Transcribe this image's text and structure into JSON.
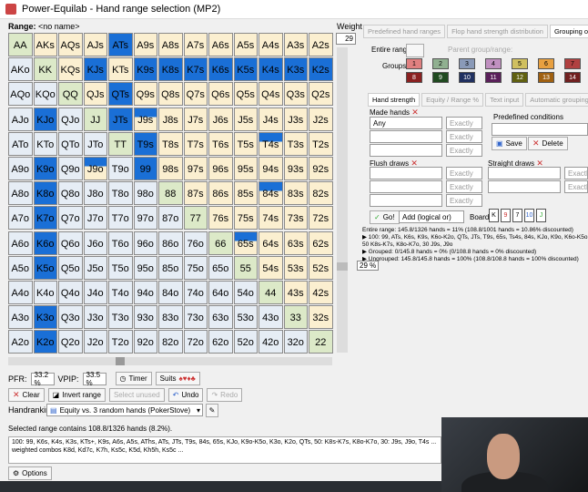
{
  "window": {
    "title": "Power-Equilab - Hand range selection (MP2)"
  },
  "range": {
    "label": "Range:",
    "name": "<no name>"
  },
  "weight": {
    "label": "Weight",
    "value": "29"
  },
  "matrix": [
    [
      "AA",
      "AKs",
      "AQs",
      "AJs",
      "ATs",
      "A9s",
      "A8s",
      "A7s",
      "A6s",
      "A5s",
      "A4s",
      "A3s",
      "A2s"
    ],
    [
      "AKo",
      "KK",
      "KQs",
      "KJs",
      "KTs",
      "K9s",
      "K8s",
      "K7s",
      "K6s",
      "K5s",
      "K4s",
      "K3s",
      "K2s"
    ],
    [
      "AQo",
      "KQo",
      "QQ",
      "QJs",
      "QTs",
      "Q9s",
      "Q8s",
      "Q7s",
      "Q6s",
      "Q5s",
      "Q4s",
      "Q3s",
      "Q2s"
    ],
    [
      "AJo",
      "KJo",
      "QJo",
      "JJ",
      "JTs",
      "J9s",
      "J8s",
      "J7s",
      "J6s",
      "J5s",
      "J4s",
      "J3s",
      "J2s"
    ],
    [
      "ATo",
      "KTo",
      "QTo",
      "JTo",
      "TT",
      "T9s",
      "T8s",
      "T7s",
      "T6s",
      "T5s",
      "T4s",
      "T3s",
      "T2s"
    ],
    [
      "A9o",
      "K9o",
      "Q9o",
      "J9o",
      "T9o",
      "99",
      "98s",
      "97s",
      "96s",
      "95s",
      "94s",
      "93s",
      "92s"
    ],
    [
      "A8o",
      "K8o",
      "Q8o",
      "J8o",
      "T8o",
      "98o",
      "88",
      "87s",
      "86s",
      "85s",
      "84s",
      "83s",
      "82s"
    ],
    [
      "A7o",
      "K7o",
      "Q7o",
      "J7o",
      "T7o",
      "97o",
      "87o",
      "77",
      "76s",
      "75s",
      "74s",
      "73s",
      "72s"
    ],
    [
      "A6o",
      "K6o",
      "Q6o",
      "J6o",
      "T6o",
      "96o",
      "86o",
      "76o",
      "66",
      "65s",
      "64s",
      "63s",
      "62s"
    ],
    [
      "A5o",
      "K5o",
      "Q5o",
      "J5o",
      "T5o",
      "95o",
      "85o",
      "75o",
      "65o",
      "55",
      "54s",
      "53s",
      "52s"
    ],
    [
      "A4o",
      "K4o",
      "Q4o",
      "J4o",
      "T4o",
      "94o",
      "84o",
      "74o",
      "64o",
      "54o",
      "44",
      "43s",
      "42s"
    ],
    [
      "A3o",
      "K3o",
      "Q3o",
      "J3o",
      "T3o",
      "93o",
      "83o",
      "73o",
      "63o",
      "53o",
      "43o",
      "33",
      "32s"
    ],
    [
      "A2o",
      "K2o",
      "Q2o",
      "J2o",
      "T2o",
      "92o",
      "82o",
      "72o",
      "62o",
      "52o",
      "42o",
      "32o",
      "22"
    ]
  ],
  "selected": [
    "ATs",
    "KJs",
    "K9s",
    "K8s",
    "K7s",
    "K6s",
    "K5s",
    "K4s",
    "K3s",
    "K2s",
    "QTs",
    "KJo",
    "JTs",
    "T9s",
    "K9o",
    "99",
    "K8o",
    "K7o",
    "K6o",
    "K5o",
    "K3o",
    "K2o"
  ],
  "partial": [
    "J9s",
    "T4s",
    "J9o",
    "84s",
    "65s"
  ],
  "controls": {
    "pfr_label": "PFR:",
    "pfr_value": "33.2 %",
    "vpip_label": "VPIP:",
    "vpip_value": "33.5 %",
    "timer": "Timer",
    "suits": "Suits",
    "clear": "Clear",
    "invert": "Invert range",
    "select_unused": "Select unused",
    "undo": "Undo",
    "redo": "Redo",
    "handranking_label": "Handranking:",
    "handranking_value": "Equity vs. 3 random hands (PokerStove)"
  },
  "summary": "Selected range contains 108.8/1326 hands (8.2%).",
  "range_text": "100: 99, K6s, K4s, K3s, KTs+, K9s, A6s, A5s, AThs, ATs, JTs, T9s, 84s, 65s, KJo, K9o-K5o, K3o, K2o, QTs, 50: K8s-K7s, K8o-K7o, 30: J9s, J9o, T4s ... weighted combos K8d, Kd7c, K7h, Ks5c, K5d, Kh5h, Ks5c ...",
  "options": "Options",
  "tabs": [
    "Predefined hand ranges",
    "Flop hand strength distribution",
    "Grouping options"
  ],
  "right": {
    "entire_range": "Entire range:",
    "parent_group": "Parent group/range:",
    "groups": "Groups:",
    "group_nums": [
      "1",
      "2",
      "3",
      "4",
      "5",
      "6",
      "7",
      "8",
      "9",
      "10",
      "11",
      "12",
      "13",
      "14"
    ],
    "group_colors": [
      "#e08080",
      "#90b090",
      "#8a9ab8",
      "#c090c0",
      "#d0c060",
      "#e8a040",
      "#b04040",
      "#8a2020",
      "#204a20",
      "#203060",
      "#5a205a",
      "#606010",
      "#a06010",
      "#702020"
    ],
    "subtabs": [
      "Hand strength",
      "Equity / Range %",
      "Text input",
      "Automatic grouping"
    ],
    "made_hands": "Made hands",
    "any": "Any",
    "exactly": "Exactly",
    "predefined_conditions": "Predefined conditions",
    "save": "Save",
    "delete": "Delete",
    "flush_draws": "Flush draws",
    "straight_draws": "Straight draws",
    "go": "Go!",
    "add_logical": "Add (logical or)",
    "board_label": "Board:",
    "board_cards": [
      "K",
      "9",
      "7",
      "10",
      "J"
    ]
  },
  "output": [
    "Entire range: 145.8/1326 hands = 11%  (108.8/1001 hands = 10.86% discounted)",
    "▶ 100: 99, ATs, K6s, K9s, K6o-K2o, QTs, JTs, T9s, 65s, Ts4s, 84s, KJo, K9o, K6o-K5o,",
    "  50 K8s-K7s, K8o-K7o, 30 J9s, J9o",
    "▶ Grouped: 0/145.8 hands = 0% (0/108.8 hands = 0% discounted)",
    "▶ Ungrouped: 145.8/145.8 hands = 100% (108.8/108.8 hands = 100% discounted)"
  ],
  "tooltip": "29 %"
}
